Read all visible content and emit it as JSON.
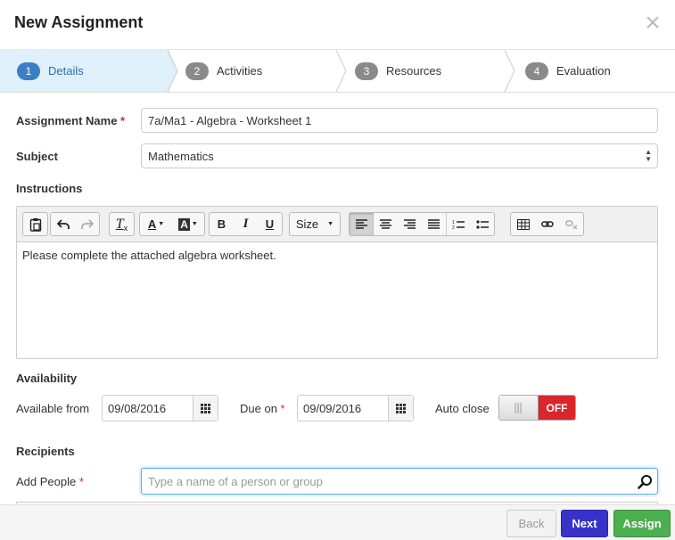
{
  "dialog": {
    "title": "New Assignment",
    "close_icon": "close-icon"
  },
  "steps": [
    {
      "num": "1",
      "label": "Details",
      "active": true
    },
    {
      "num": "2",
      "label": "Activities",
      "active": false
    },
    {
      "num": "3",
      "label": "Resources",
      "active": false
    },
    {
      "num": "4",
      "label": "Evaluation",
      "active": false
    }
  ],
  "form": {
    "assignment_name_label": "Assignment Name",
    "assignment_name_value": "7a/Ma1 - Algebra - Worksheet 1",
    "subject_label": "Subject",
    "subject_value": "Mathematics",
    "instructions_label": "Instructions",
    "instructions_text": "Please complete the attached algebra worksheet.",
    "availability_label": "Availability",
    "available_from_label": "Available from",
    "available_from_value": "09/08/2016",
    "due_on_label": "Due on",
    "due_on_value": "09/09/2016",
    "auto_close_label": "Auto close",
    "auto_close_state": "OFF",
    "recipients_label": "Recipients",
    "add_people_label": "Add People",
    "add_people_placeholder": "Type a name of a person or group",
    "required_marker": "*"
  },
  "toolbar": {
    "size_label": "Size",
    "icons": [
      "paste-icon",
      "undo-icon",
      "redo-icon",
      "clear-format-icon",
      "font-color-icon",
      "background-color-icon",
      "bold-icon",
      "italic-icon",
      "underline-icon",
      "size-dropdown",
      "align-left-icon",
      "align-center-icon",
      "align-right-icon",
      "align-justify-icon",
      "ordered-list-icon",
      "unordered-list-icon",
      "table-icon",
      "link-icon",
      "unlink-icon"
    ]
  },
  "footer": {
    "back_label": "Back",
    "next_label": "Next",
    "assign_label": "Assign"
  },
  "colors": {
    "active_step_bg": "#dff0fb",
    "active_step_badge": "#3b7fc4",
    "toggle_off": "#d9262b",
    "next_button": "#3733c9",
    "assign_button": "#4caf50",
    "required": "#c9302c"
  }
}
